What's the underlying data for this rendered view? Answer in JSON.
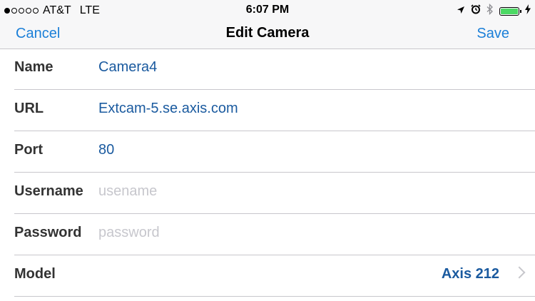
{
  "status_bar": {
    "carrier": "AT&T",
    "network": "LTE",
    "time": "6:07 PM",
    "signal_bars": 1,
    "signal_total": 5,
    "battery_level": 1.0,
    "icons": [
      "location-arrow-icon",
      "alarm-icon",
      "bluetooth-icon",
      "battery-icon",
      "charging-bolt-icon"
    ]
  },
  "navbar": {
    "cancel_label": "Cancel",
    "title": "Edit Camera",
    "save_label": "Save"
  },
  "form": {
    "name": {
      "label": "Name",
      "value": "Camera4"
    },
    "url": {
      "label": "URL",
      "value": "Extcam-5.se.axis.com"
    },
    "port": {
      "label": "Port",
      "value": "80"
    },
    "username": {
      "label": "Username",
      "value": "",
      "placeholder": "usename"
    },
    "password": {
      "label": "Password",
      "value": "",
      "placeholder": "password"
    },
    "model": {
      "label": "Model",
      "value": "Axis 212"
    }
  },
  "colors": {
    "accent": "#1b7fd8",
    "value_text": "#1a5a9f",
    "battery_fill": "#4cd964",
    "separator": "#c8c7cc"
  }
}
